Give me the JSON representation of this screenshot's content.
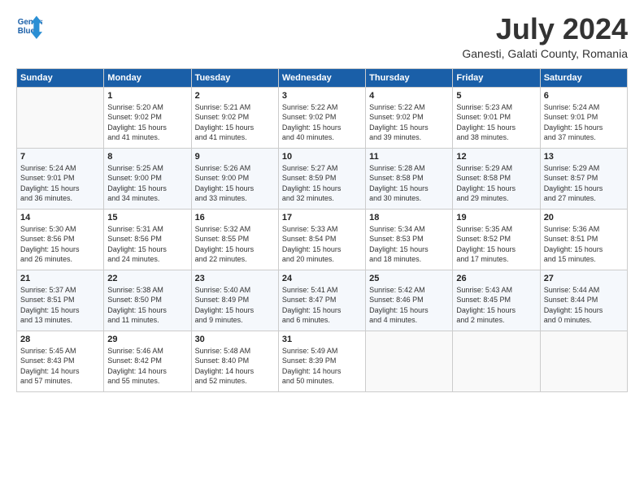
{
  "header": {
    "logo_line1": "General",
    "logo_line2": "Blue",
    "main_title": "July 2024",
    "subtitle": "Ganesti, Galati County, Romania"
  },
  "columns": [
    "Sunday",
    "Monday",
    "Tuesday",
    "Wednesday",
    "Thursday",
    "Friday",
    "Saturday"
  ],
  "weeks": [
    [
      {
        "day": "",
        "info": ""
      },
      {
        "day": "1",
        "info": "Sunrise: 5:20 AM\nSunset: 9:02 PM\nDaylight: 15 hours\nand 41 minutes."
      },
      {
        "day": "2",
        "info": "Sunrise: 5:21 AM\nSunset: 9:02 PM\nDaylight: 15 hours\nand 41 minutes."
      },
      {
        "day": "3",
        "info": "Sunrise: 5:22 AM\nSunset: 9:02 PM\nDaylight: 15 hours\nand 40 minutes."
      },
      {
        "day": "4",
        "info": "Sunrise: 5:22 AM\nSunset: 9:02 PM\nDaylight: 15 hours\nand 39 minutes."
      },
      {
        "day": "5",
        "info": "Sunrise: 5:23 AM\nSunset: 9:01 PM\nDaylight: 15 hours\nand 38 minutes."
      },
      {
        "day": "6",
        "info": "Sunrise: 5:24 AM\nSunset: 9:01 PM\nDaylight: 15 hours\nand 37 minutes."
      }
    ],
    [
      {
        "day": "7",
        "info": "Sunrise: 5:24 AM\nSunset: 9:01 PM\nDaylight: 15 hours\nand 36 minutes."
      },
      {
        "day": "8",
        "info": "Sunrise: 5:25 AM\nSunset: 9:00 PM\nDaylight: 15 hours\nand 34 minutes."
      },
      {
        "day": "9",
        "info": "Sunrise: 5:26 AM\nSunset: 9:00 PM\nDaylight: 15 hours\nand 33 minutes."
      },
      {
        "day": "10",
        "info": "Sunrise: 5:27 AM\nSunset: 8:59 PM\nDaylight: 15 hours\nand 32 minutes."
      },
      {
        "day": "11",
        "info": "Sunrise: 5:28 AM\nSunset: 8:58 PM\nDaylight: 15 hours\nand 30 minutes."
      },
      {
        "day": "12",
        "info": "Sunrise: 5:29 AM\nSunset: 8:58 PM\nDaylight: 15 hours\nand 29 minutes."
      },
      {
        "day": "13",
        "info": "Sunrise: 5:29 AM\nSunset: 8:57 PM\nDaylight: 15 hours\nand 27 minutes."
      }
    ],
    [
      {
        "day": "14",
        "info": "Sunrise: 5:30 AM\nSunset: 8:56 PM\nDaylight: 15 hours\nand 26 minutes."
      },
      {
        "day": "15",
        "info": "Sunrise: 5:31 AM\nSunset: 8:56 PM\nDaylight: 15 hours\nand 24 minutes."
      },
      {
        "day": "16",
        "info": "Sunrise: 5:32 AM\nSunset: 8:55 PM\nDaylight: 15 hours\nand 22 minutes."
      },
      {
        "day": "17",
        "info": "Sunrise: 5:33 AM\nSunset: 8:54 PM\nDaylight: 15 hours\nand 20 minutes."
      },
      {
        "day": "18",
        "info": "Sunrise: 5:34 AM\nSunset: 8:53 PM\nDaylight: 15 hours\nand 18 minutes."
      },
      {
        "day": "19",
        "info": "Sunrise: 5:35 AM\nSunset: 8:52 PM\nDaylight: 15 hours\nand 17 minutes."
      },
      {
        "day": "20",
        "info": "Sunrise: 5:36 AM\nSunset: 8:51 PM\nDaylight: 15 hours\nand 15 minutes."
      }
    ],
    [
      {
        "day": "21",
        "info": "Sunrise: 5:37 AM\nSunset: 8:51 PM\nDaylight: 15 hours\nand 13 minutes."
      },
      {
        "day": "22",
        "info": "Sunrise: 5:38 AM\nSunset: 8:50 PM\nDaylight: 15 hours\nand 11 minutes."
      },
      {
        "day": "23",
        "info": "Sunrise: 5:40 AM\nSunset: 8:49 PM\nDaylight: 15 hours\nand 9 minutes."
      },
      {
        "day": "24",
        "info": "Sunrise: 5:41 AM\nSunset: 8:47 PM\nDaylight: 15 hours\nand 6 minutes."
      },
      {
        "day": "25",
        "info": "Sunrise: 5:42 AM\nSunset: 8:46 PM\nDaylight: 15 hours\nand 4 minutes."
      },
      {
        "day": "26",
        "info": "Sunrise: 5:43 AM\nSunset: 8:45 PM\nDaylight: 15 hours\nand 2 minutes."
      },
      {
        "day": "27",
        "info": "Sunrise: 5:44 AM\nSunset: 8:44 PM\nDaylight: 15 hours\nand 0 minutes."
      }
    ],
    [
      {
        "day": "28",
        "info": "Sunrise: 5:45 AM\nSunset: 8:43 PM\nDaylight: 14 hours\nand 57 minutes."
      },
      {
        "day": "29",
        "info": "Sunrise: 5:46 AM\nSunset: 8:42 PM\nDaylight: 14 hours\nand 55 minutes."
      },
      {
        "day": "30",
        "info": "Sunrise: 5:48 AM\nSunset: 8:40 PM\nDaylight: 14 hours\nand 52 minutes."
      },
      {
        "day": "31",
        "info": "Sunrise: 5:49 AM\nSunset: 8:39 PM\nDaylight: 14 hours\nand 50 minutes."
      },
      {
        "day": "",
        "info": ""
      },
      {
        "day": "",
        "info": ""
      },
      {
        "day": "",
        "info": ""
      }
    ]
  ]
}
